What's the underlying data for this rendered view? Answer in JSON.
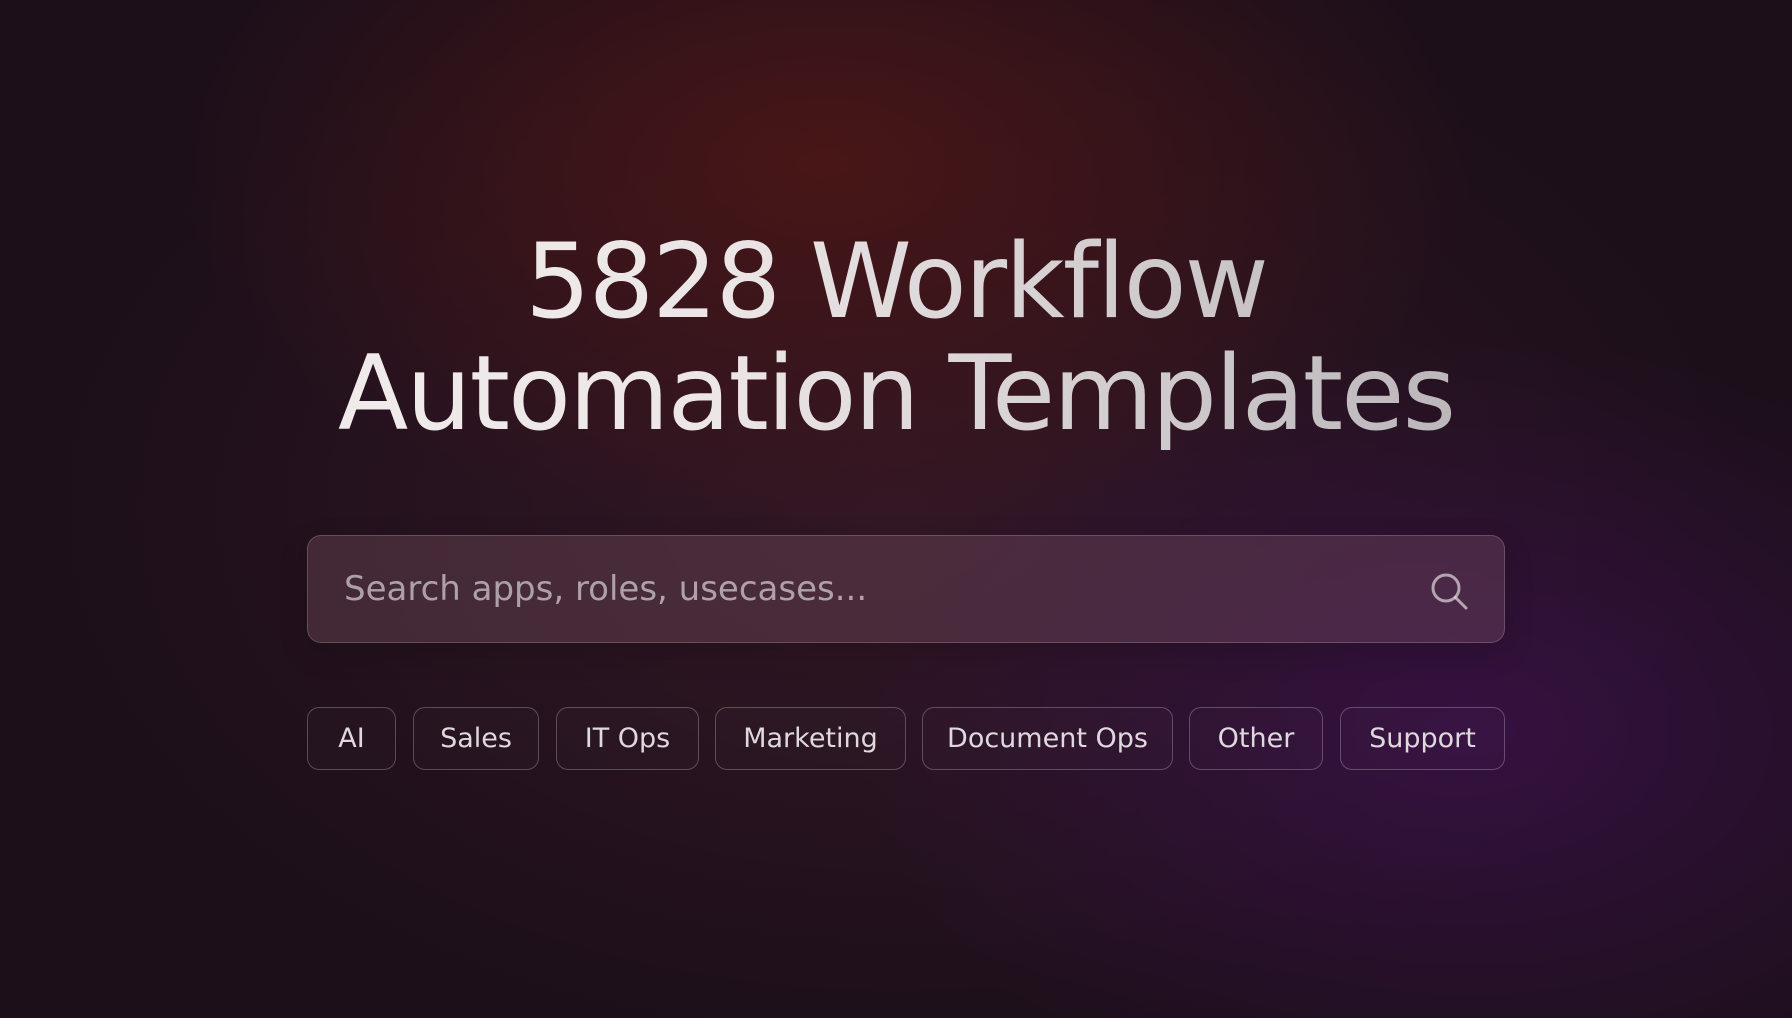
{
  "hero": {
    "title_line_1": "5828 Workflow",
    "title_line_2": "Automation Templates"
  },
  "search": {
    "placeholder": "Search apps, roles, usecases...",
    "icon": "search-icon"
  },
  "filters": [
    {
      "label": "AI",
      "name": "filter-ai"
    },
    {
      "label": "Sales",
      "name": "filter-sales"
    },
    {
      "label": "IT Ops",
      "name": "filter-it-ops"
    },
    {
      "label": "Marketing",
      "name": "filter-marketing"
    },
    {
      "label": "Document Ops",
      "name": "filter-document-ops"
    },
    {
      "label": "Other",
      "name": "filter-other"
    },
    {
      "label": "Support",
      "name": "filter-support"
    }
  ]
}
